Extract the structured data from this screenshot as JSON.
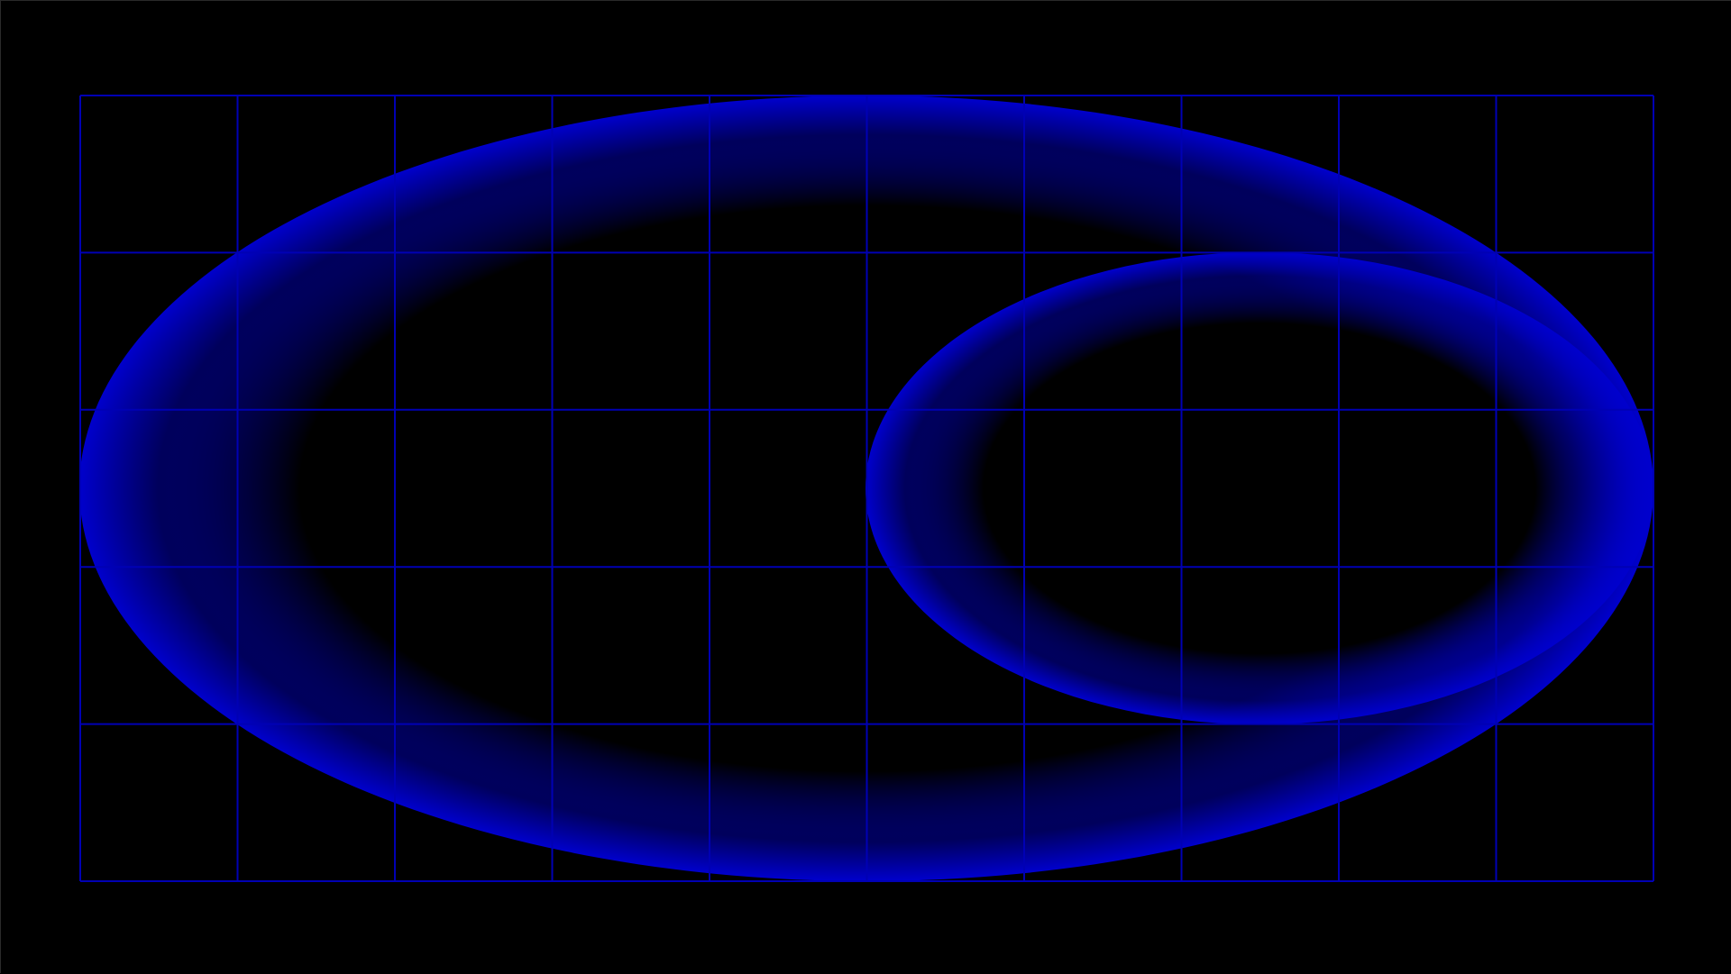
{
  "colors": {
    "background": "#000000",
    "grid_line": "#0000b4",
    "ellipse_edge": "#0000cc",
    "ellipse_center": "#000000"
  },
  "grid": {
    "columns": 10,
    "rows": 5
  },
  "shapes": [
    {
      "name": "large-glow-ellipse",
      "kind": "ellipse",
      "fill": "radial-gradient"
    },
    {
      "name": "small-glow-ellipse",
      "kind": "ellipse",
      "fill": "radial-gradient"
    }
  ]
}
